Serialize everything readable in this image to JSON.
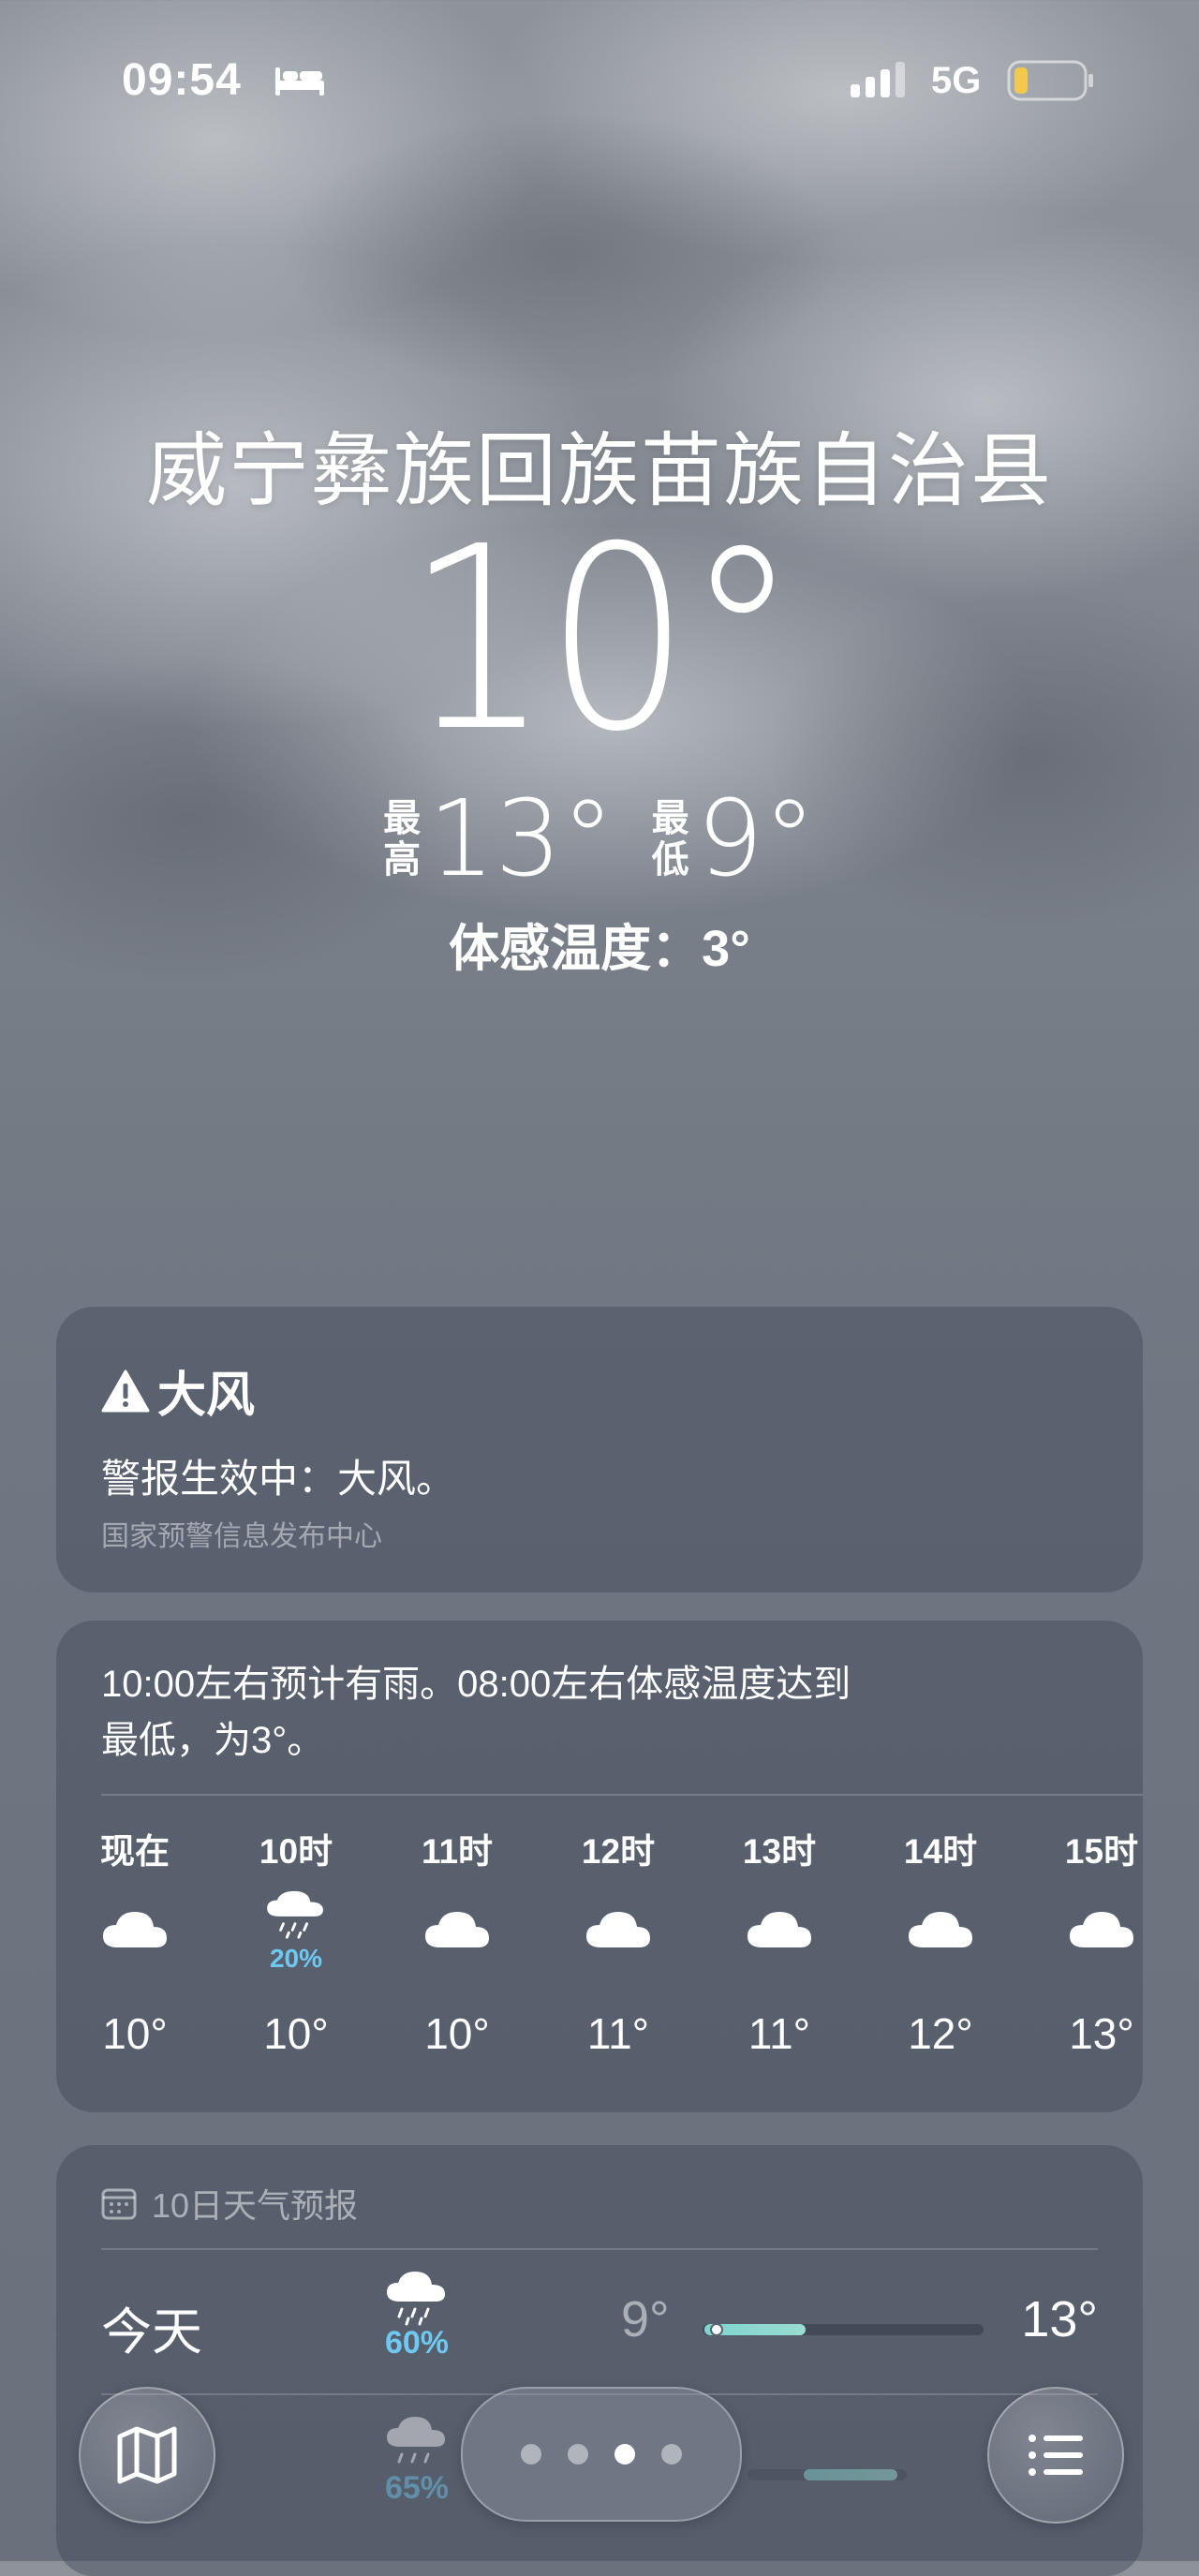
{
  "status_bar": {
    "time": "09:54",
    "network": "5G",
    "icons": [
      "bed-icon",
      "signal-icon",
      "battery-icon"
    ],
    "battery_color": "#f2c94c"
  },
  "header": {
    "location": "威宁彝族回族苗族自治县",
    "temperature": "10°",
    "high_label_top": "最",
    "high_label_bottom": "高",
    "high_value": "13°",
    "low_label_top": "最",
    "low_label_bottom": "低",
    "low_value": "9°",
    "feels_like": "体感温度：3°"
  },
  "alert": {
    "icon": "warning-triangle-icon",
    "title": "大风",
    "text": "警报生效中：大风。",
    "source": "国家预警信息发布中心"
  },
  "hourly": {
    "summary_line1": "10:00左右预计有雨。08:00左右体感温度达到",
    "summary_line2": "最低，为3°。",
    "hours": [
      {
        "label": "现在",
        "icon": "cloud-icon",
        "precip": "",
        "temp": "10°"
      },
      {
        "label": "10时",
        "icon": "cloud-rain-icon",
        "precip": "20%",
        "temp": "10°"
      },
      {
        "label": "11时",
        "icon": "cloud-icon",
        "precip": "",
        "temp": "10°"
      },
      {
        "label": "12时",
        "icon": "cloud-icon",
        "precip": "",
        "temp": "11°"
      },
      {
        "label": "13时",
        "icon": "cloud-icon",
        "precip": "",
        "temp": "11°"
      },
      {
        "label": "14时",
        "icon": "cloud-icon",
        "precip": "",
        "temp": "12°"
      },
      {
        "label": "15时",
        "icon": "cloud-icon",
        "precip": "",
        "temp": "13°"
      }
    ],
    "precip_color": "#6fc8f2"
  },
  "daily": {
    "title": "10日天气预报",
    "icon": "calendar-icon",
    "days": [
      {
        "name": "今天",
        "icon": "cloud-rain-icon",
        "precip": "60%",
        "low": "9°",
        "high": "13°"
      },
      {
        "name": "",
        "icon": "cloud-rain-icon",
        "precip": "65%",
        "low": "",
        "high": ""
      }
    ]
  },
  "bottom_bar": {
    "map_icon": "map-icon",
    "list_icon": "list-icon",
    "page_count": 4,
    "active_page": 3
  }
}
